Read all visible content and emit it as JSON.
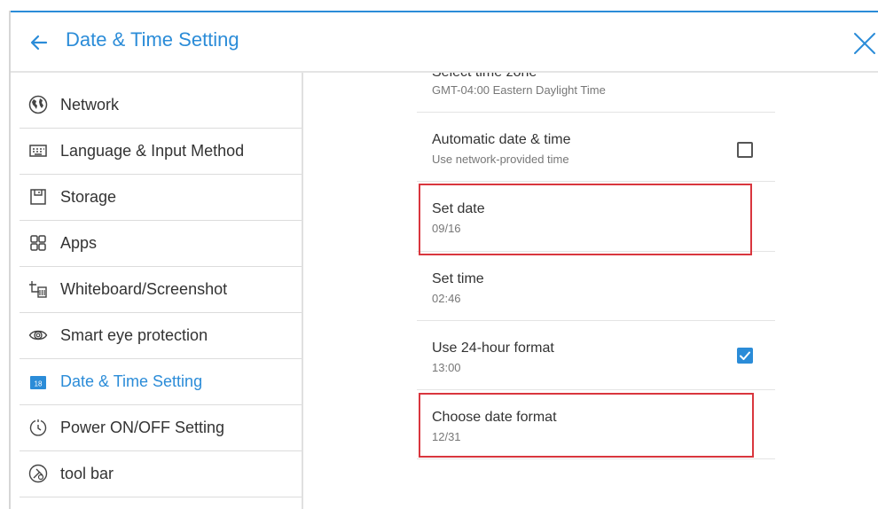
{
  "header": {
    "title": "Date & Time Setting"
  },
  "sidebar": {
    "items": [
      {
        "label": "Network",
        "icon": "globe-icon"
      },
      {
        "label": "Language & Input Method",
        "icon": "keyboard-icon"
      },
      {
        "label": "Storage",
        "icon": "storage-icon"
      },
      {
        "label": "Apps",
        "icon": "apps-grid-icon"
      },
      {
        "label": "Whiteboard/Screenshot",
        "icon": "whiteboard-icon"
      },
      {
        "label": "Smart eye protection",
        "icon": "eye-icon"
      },
      {
        "label": "Date & Time Setting",
        "icon": "calendar-icon",
        "calendar_number": "18",
        "active": true
      },
      {
        "label": "Power ON/OFF Setting",
        "icon": "power-timer-icon"
      },
      {
        "label": "tool bar",
        "icon": "toolbar-icon"
      }
    ]
  },
  "settings": {
    "time_zone": {
      "title": "Select time zone",
      "value": "GMT-04:00 Eastern Daylight Time"
    },
    "automatic": {
      "title": "Automatic date & time",
      "subtitle": "Use network-provided time",
      "checked": false
    },
    "set_date": {
      "title": "Set date",
      "value": "09/16"
    },
    "set_time": {
      "title": "Set time",
      "value": "02:46"
    },
    "hour24": {
      "title": "Use 24-hour format",
      "value": "13:00",
      "checked": true
    },
    "date_format": {
      "title": "Choose date format",
      "value": "12/31"
    }
  },
  "colors": {
    "accent": "#2b8cd8",
    "highlight": "#d9363e"
  }
}
